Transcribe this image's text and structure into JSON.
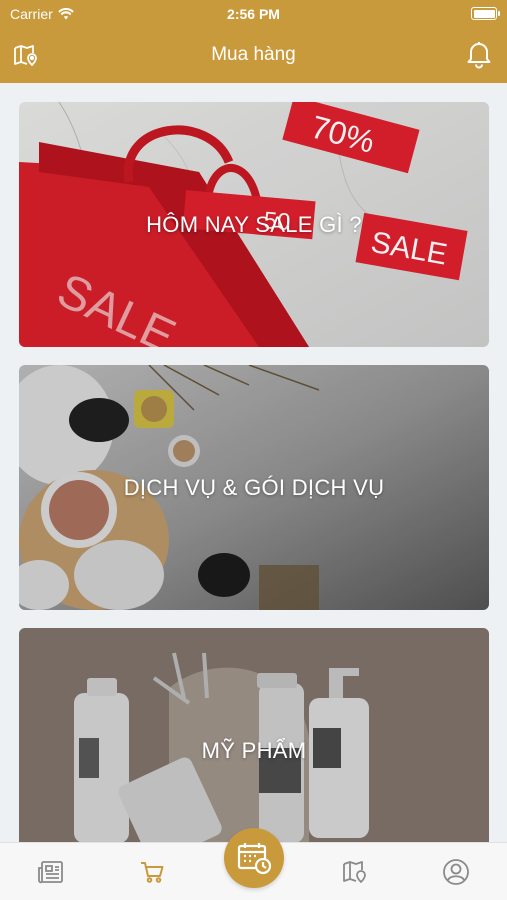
{
  "status": {
    "carrier": "Carrier",
    "time": "2:56 PM"
  },
  "header": {
    "title": "Mua hàng"
  },
  "cards": [
    {
      "label": "HÔM NAY SALE GÌ ?",
      "image_text": [
        "70%",
        "SALE",
        "SALE",
        "50"
      ]
    },
    {
      "label": "DỊCH VỤ & GÓI DỊCH VỤ"
    },
    {
      "label": "MỸ PHẨM"
    }
  ],
  "tabs": [
    {
      "icon": "news-icon",
      "active": false
    },
    {
      "icon": "cart-icon",
      "active": true
    },
    {
      "icon": "calendar-clock-icon",
      "active": false
    },
    {
      "icon": "map-icon",
      "active": false
    },
    {
      "icon": "profile-icon",
      "active": false
    }
  ],
  "colors": {
    "brand": "#c99a3c",
    "inactive_icon": "#8a8a8a",
    "sale_red": "#d81f2a"
  }
}
